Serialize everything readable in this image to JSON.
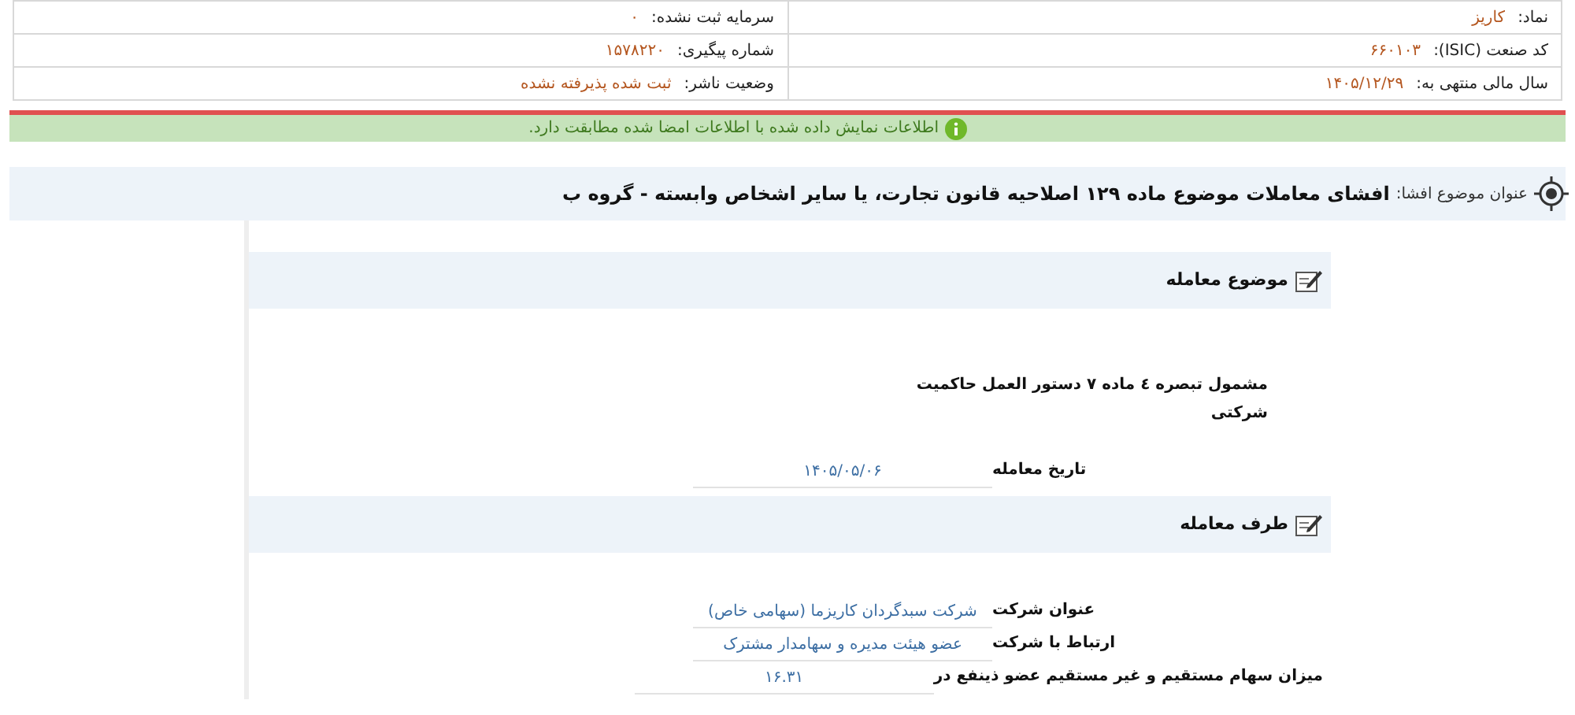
{
  "info_table": [
    {
      "right": {
        "label": "نماد:",
        "value": "کاریز"
      },
      "left": {
        "label": "سرمایه ثبت نشده:",
        "value": "۰"
      }
    },
    {
      "right": {
        "label": "کد صنعت (ISIC):",
        "value": "۶۶۰۱۰۳"
      },
      "left": {
        "label": "شماره پیگیری:",
        "value": "۱۵۷۸۲۲۰"
      }
    },
    {
      "right": {
        "label": "سال مالی منتهی به:",
        "value": "۱۴۰۵/۱۲/۲۹"
      },
      "left": {
        "label": "وضعیت ناشر:",
        "value": "ثبت شده پذیرفته نشده"
      }
    }
  ],
  "notice": {
    "text": "اطلاعات نمایش داده شده با اطلاعات امضا شده مطابقت دارد."
  },
  "subject": {
    "label": "عنوان موضوع افشا:",
    "value": "افشای معاملات موضوع ماده ۱۲۹ اصلاحیه قانون تجارت، یا سایر اشخاص وابسته - گروه ب"
  },
  "sections": [
    {
      "title": "موضوع معامله",
      "fields": [
        {
          "kind": "note",
          "text": "مشمول تبصره ٤ ماده ۷ دستور العمل حاکمیت شرکتی"
        },
        {
          "kind": "field",
          "label": "تاریخ معامله",
          "value": "۱۴۰۵/۰۵/۰۶"
        }
      ]
    },
    {
      "title": "طرف معامله",
      "fields": [
        {
          "kind": "field",
          "label": "عنوان شرکت",
          "value": "شرکت سبدگردان کاریزما (سهامی خاص)"
        },
        {
          "kind": "field",
          "label": "ارتباط با شرکت",
          "value": "عضو هیئت مدیره و سهامدار مشترک"
        },
        {
          "kind": "field",
          "label": "میزان سهام مستقیم و غیر مستقیم عضو ذینفع در",
          "value": "۱۶.۳۱"
        }
      ]
    }
  ]
}
